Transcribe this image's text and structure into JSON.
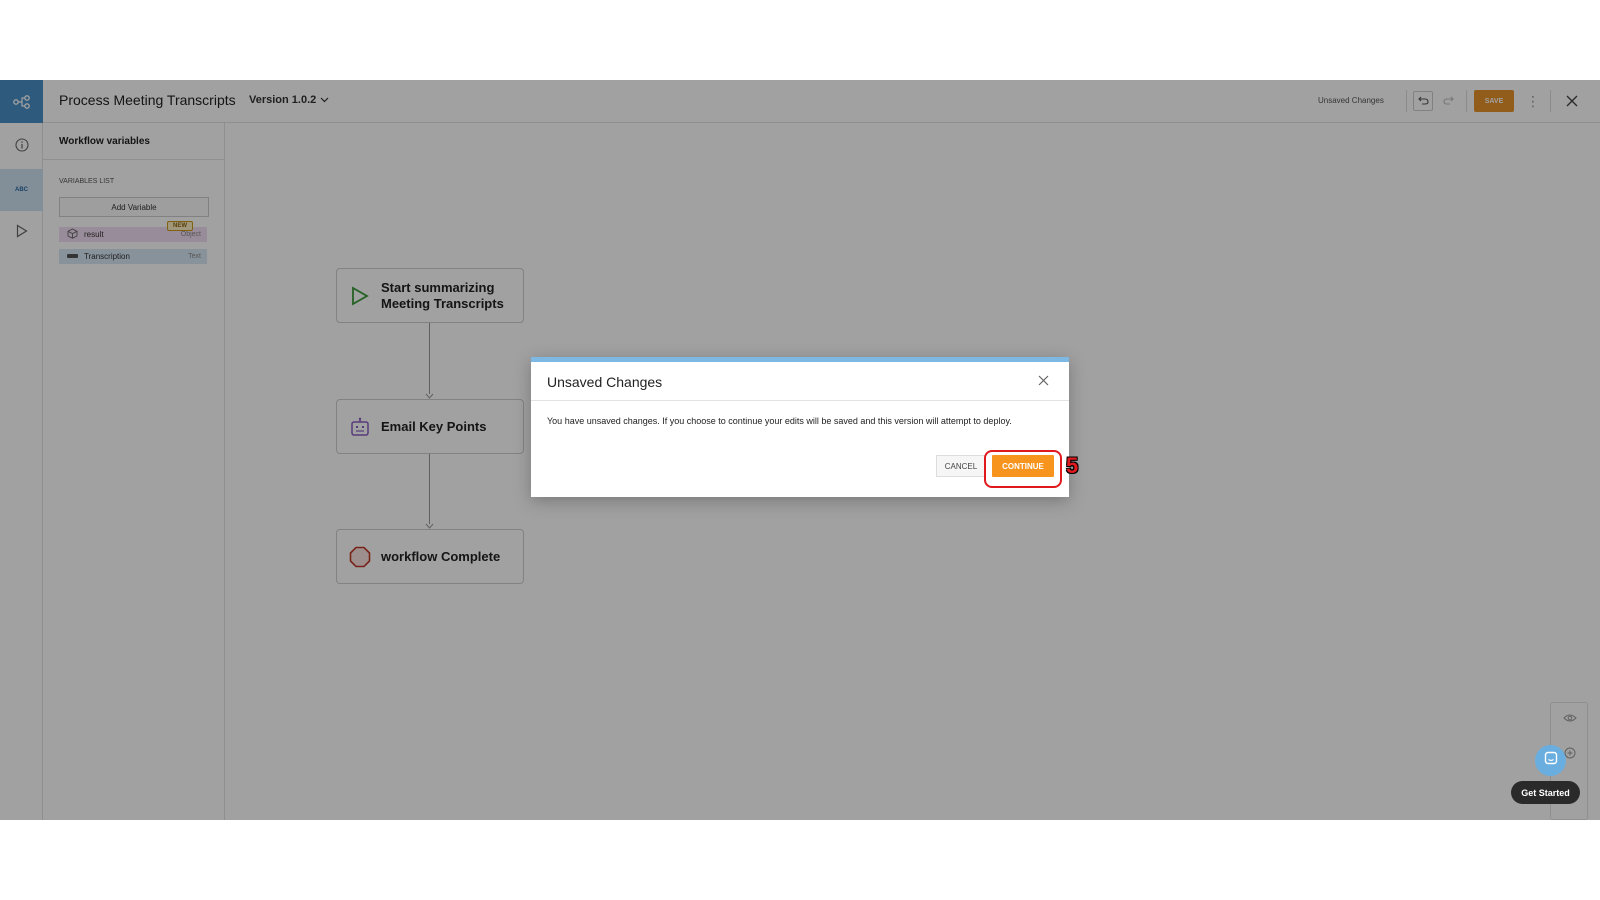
{
  "header": {
    "title": "Process Meeting Transcripts",
    "version": "Version 1.0.2",
    "status": "Unsaved Changes",
    "save_label": "SAVE"
  },
  "panel": {
    "title": "Workflow variables",
    "list_title": "VARIABLES LIST",
    "add_label": "Add Variable",
    "rail_abc": "ABC",
    "variables": [
      {
        "name": "result",
        "type": "Object",
        "badge": "NEW"
      },
      {
        "name": "Transcription",
        "type": "Text"
      }
    ]
  },
  "nodes": [
    {
      "label": "Start summarizing Meeting Transcripts",
      "icon": "play-icon"
    },
    {
      "label": "Email Key Points",
      "icon": "robot-icon"
    },
    {
      "label": "workflow Complete",
      "icon": "stop-octagon-icon"
    }
  ],
  "dialog": {
    "title": "Unsaved Changes",
    "message": "You have unsaved changes. If you choose to continue your edits will be saved and this version will attempt to deploy.",
    "cancel_label": "CANCEL",
    "continue_label": "CONTINUE"
  },
  "annotation": {
    "step": "5"
  },
  "chat": {
    "label": "Get Started"
  },
  "colors": {
    "accent": "#f7941d",
    "rail_active": "#cfe3f3",
    "dialog_bar": "#7db7e3",
    "highlight": "#e0191e"
  }
}
